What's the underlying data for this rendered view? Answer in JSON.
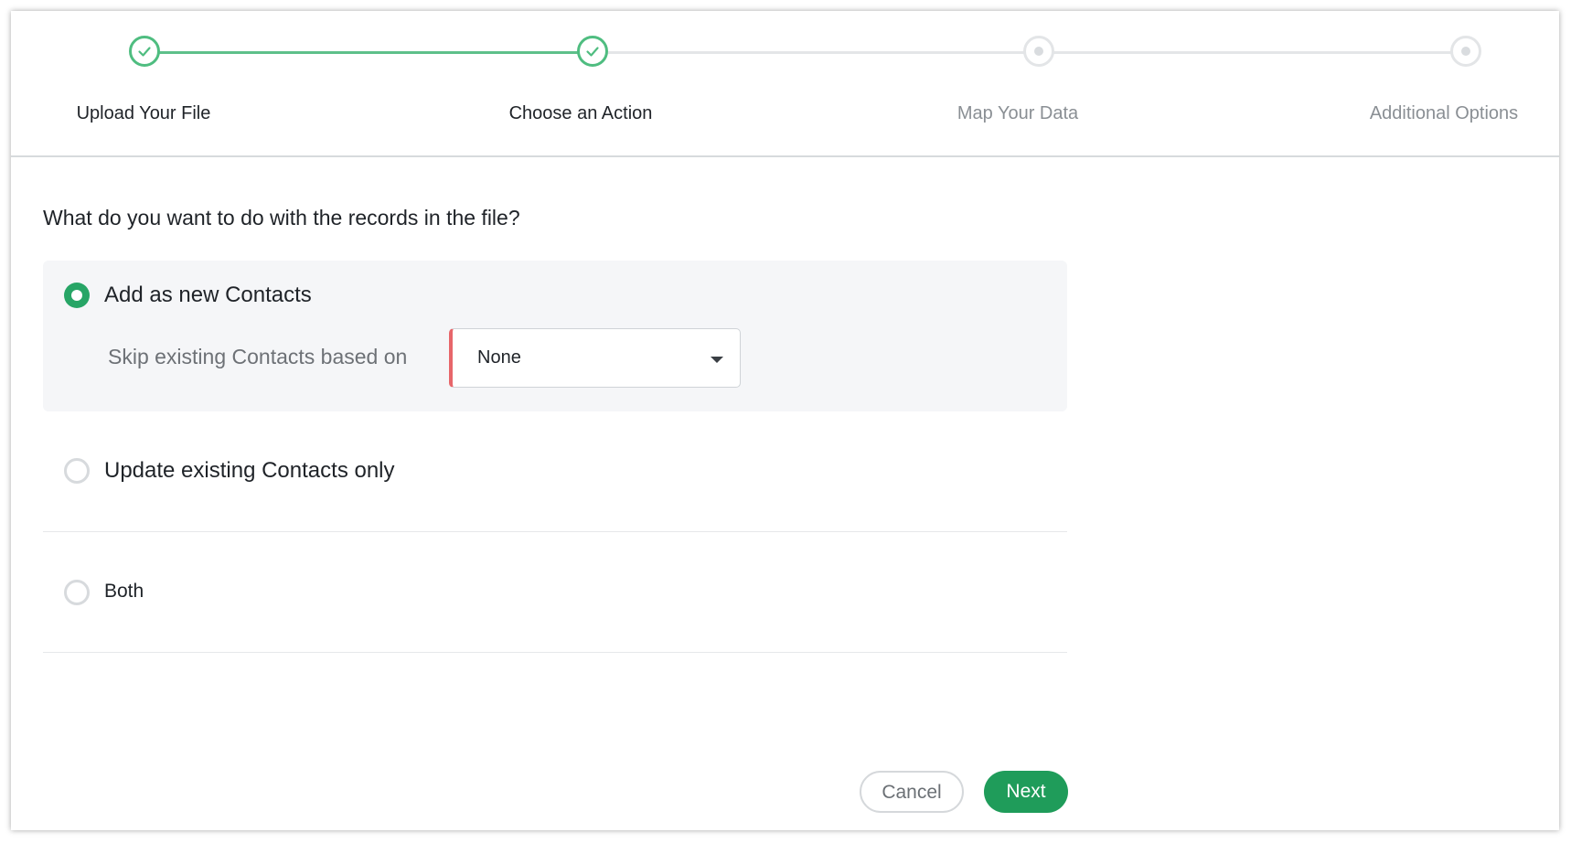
{
  "stepper": {
    "steps": [
      {
        "label": "Upload Your File",
        "status": "done"
      },
      {
        "label": "Choose an Action",
        "status": "done"
      },
      {
        "label": "Map Your Data",
        "status": "todo"
      },
      {
        "label": "Additional Options",
        "status": "todo"
      }
    ],
    "colors": {
      "done": "#4fbd80",
      "todo": "#e3e5e7"
    }
  },
  "main": {
    "question": "What do you want to do with the records in the file?",
    "options": [
      {
        "label": "Add as new Contacts",
        "selected": true
      },
      {
        "label": "Update existing Contacts only",
        "selected": false
      },
      {
        "label": "Both",
        "selected": false
      }
    ],
    "skip": {
      "label": "Skip existing Contacts based on",
      "value": "None"
    }
  },
  "footer": {
    "cancel_label": "Cancel",
    "next_label": "Next"
  },
  "colors": {
    "accent": "#1f9c5a",
    "radio_on": "#27a566",
    "select_flag": "#e7666a"
  }
}
